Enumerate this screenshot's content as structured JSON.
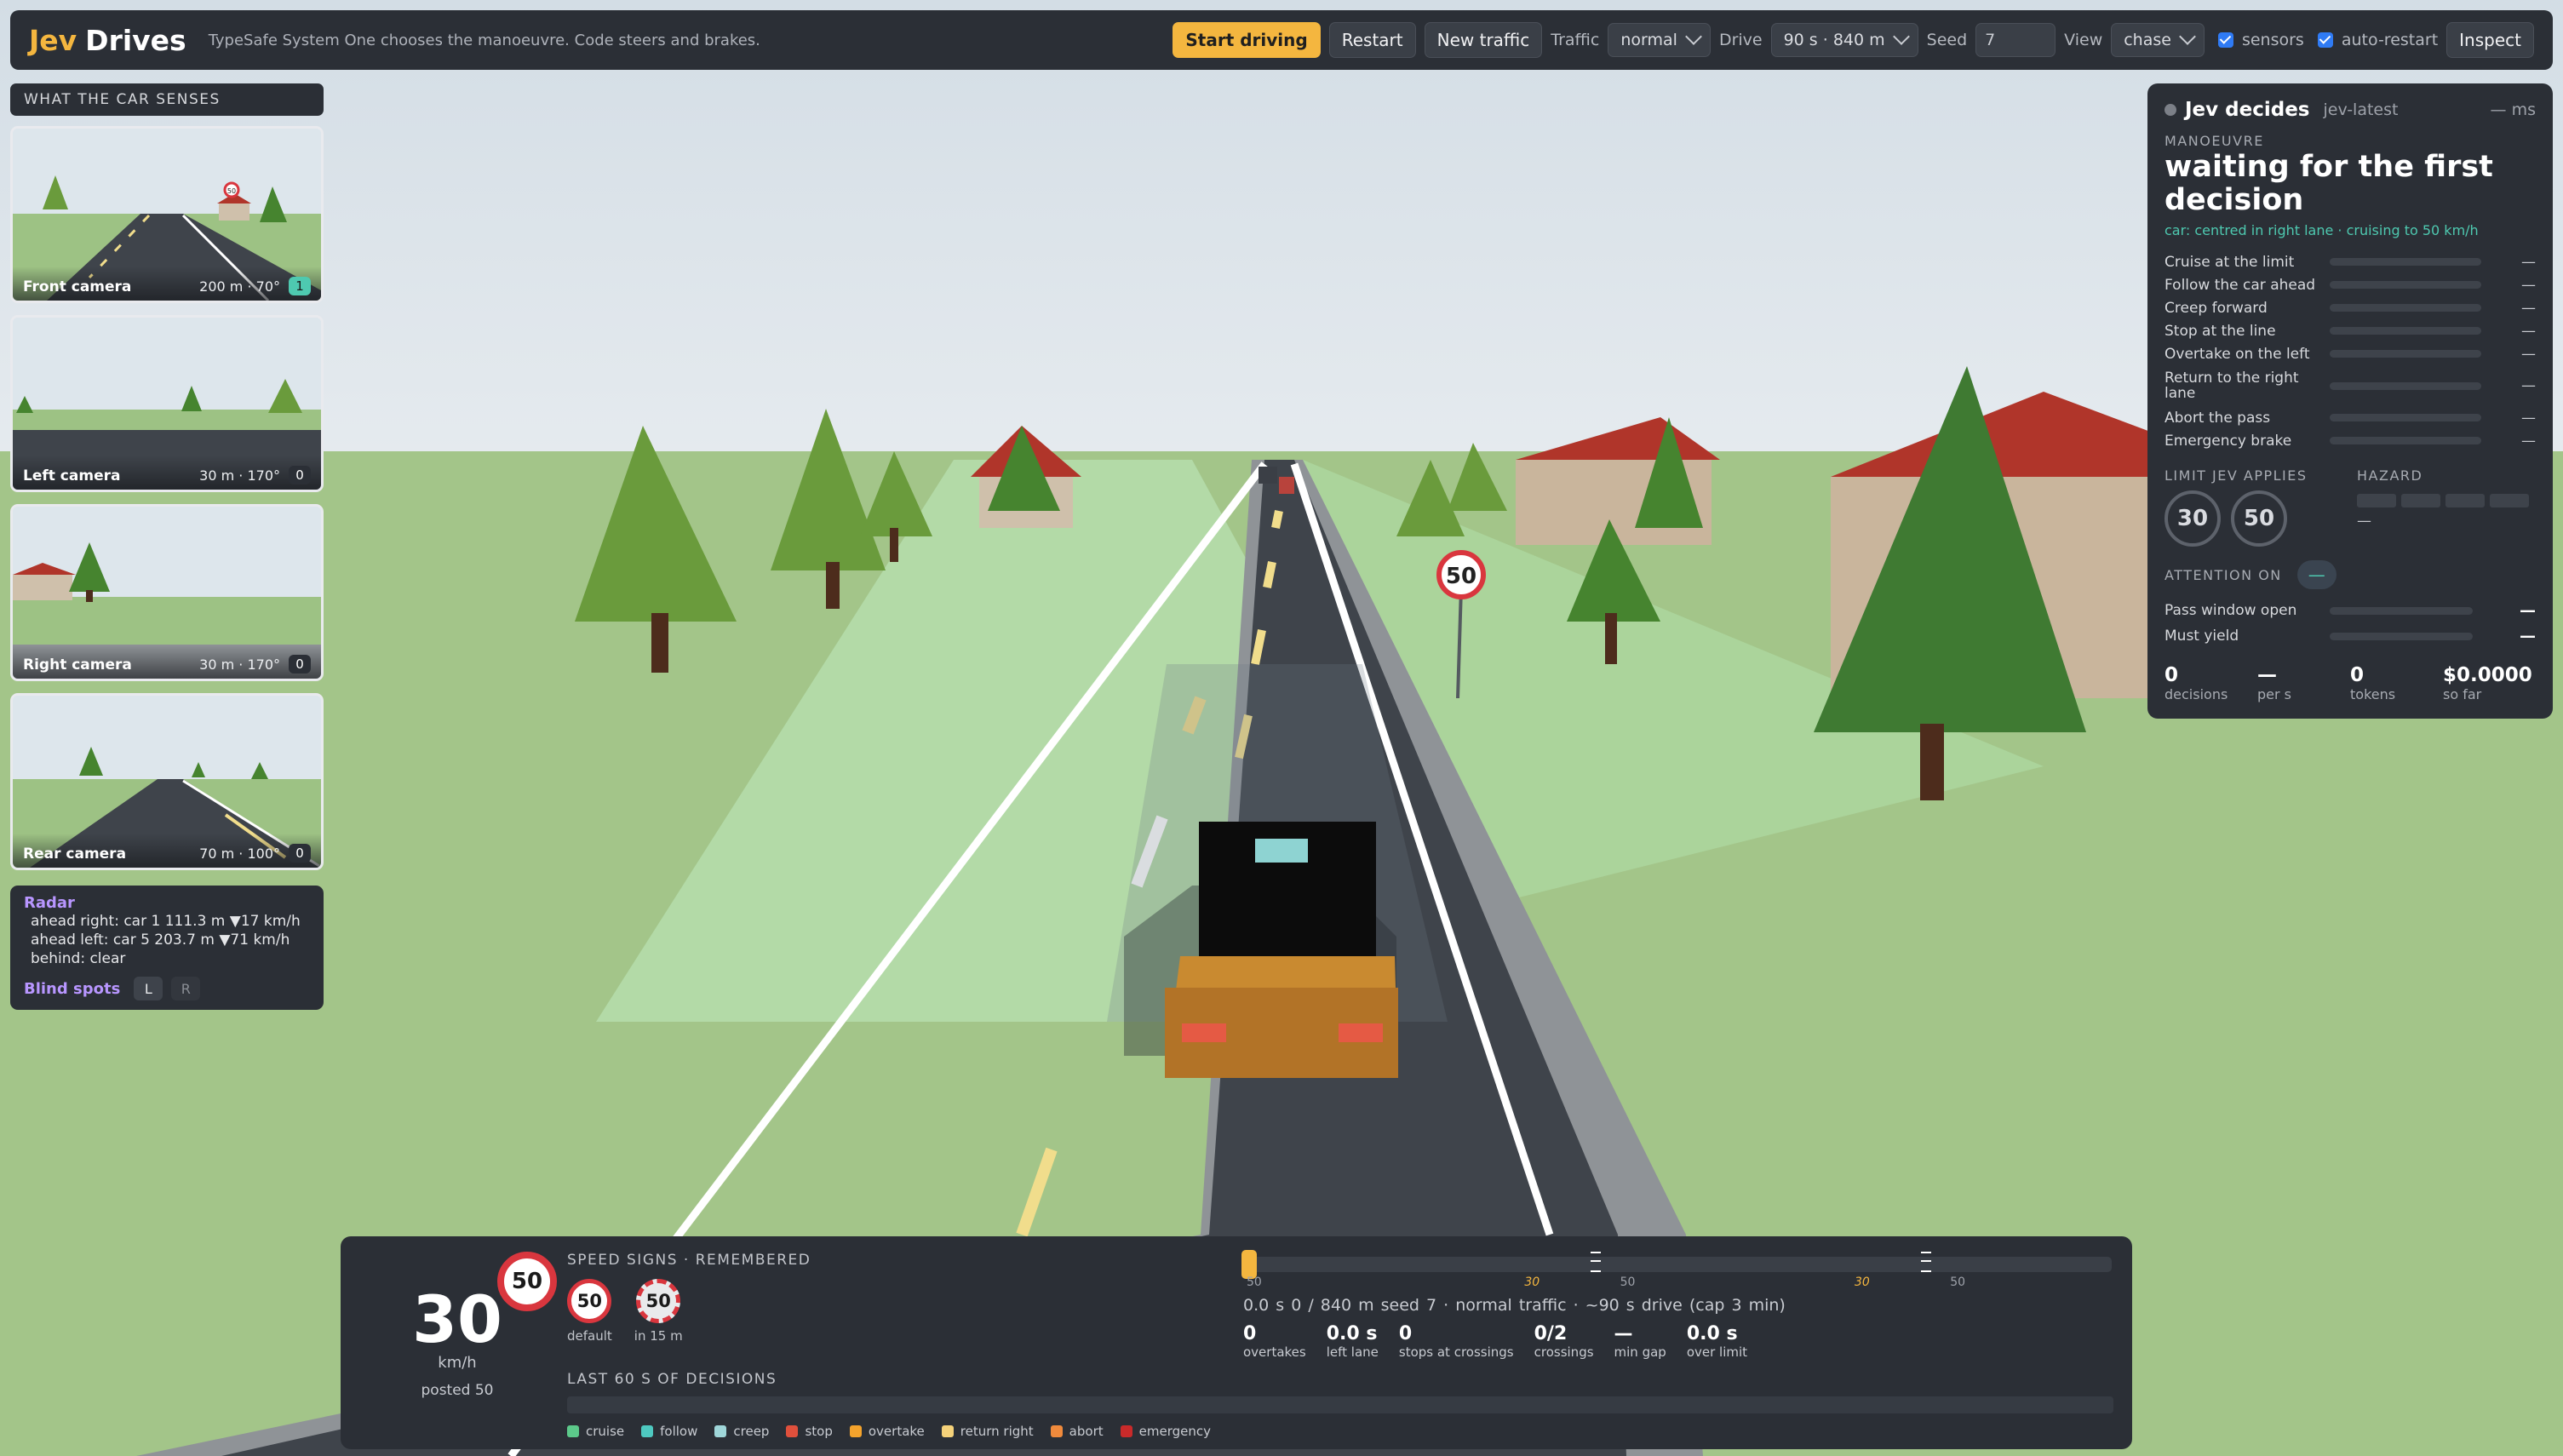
{
  "header": {
    "brand_accent": "Jev",
    "brand_name": "Drives",
    "tagline": "TypeSafe System One chooses the manoeuvre. Code steers and brakes.",
    "buttons": {
      "start": "Start driving",
      "restart": "Restart",
      "new_traffic": "New traffic",
      "inspect": "Inspect"
    },
    "traffic": {
      "label": "Traffic",
      "value": "normal"
    },
    "drive": {
      "label": "Drive",
      "value": "90 s · 840 m"
    },
    "seed": {
      "label": "Seed",
      "value": "7"
    },
    "view": {
      "label": "View",
      "value": "chase"
    },
    "sensors": {
      "label": "sensors",
      "checked": true
    },
    "auto_restart": {
      "label": "auto-restart",
      "checked": true
    }
  },
  "senses": {
    "title": "WHAT THE CAR SENSES",
    "cameras": [
      {
        "label": "Front camera",
        "meta": "200 m · 70°",
        "count": "1",
        "highlight": true
      },
      {
        "label": "Left camera",
        "meta": "30 m · 170°",
        "count": "0",
        "highlight": false
      },
      {
        "label": "Right camera",
        "meta": "30 m · 170°",
        "count": "0",
        "highlight": false
      },
      {
        "label": "Rear camera",
        "meta": "70 m · 100°",
        "count": "0",
        "highlight": false
      }
    ],
    "front_sign": "50",
    "radar": {
      "title": "Radar",
      "lines": [
        "ahead right: car 1 111.3 m ▼17 km/h",
        "ahead left: car 5 203.7 m ▼71 km/h",
        "behind: clear"
      ]
    },
    "blind_spots": {
      "title": "Blind spots",
      "left": "L",
      "right": "R"
    }
  },
  "decision": {
    "title": "Jev decides",
    "model": "jev-latest",
    "latency": "— ms",
    "manoeuvre_label": "MANOEUVRE",
    "manoeuvre": "waiting for the first decision",
    "car_status": "car: centred in right lane · cruising to 50 km/h",
    "options": [
      {
        "name": "Cruise at the limit",
        "value": "—"
      },
      {
        "name": "Follow the car ahead",
        "value": "—"
      },
      {
        "name": "Creep forward",
        "value": "—"
      },
      {
        "name": "Stop at the line",
        "value": "—"
      },
      {
        "name": "Overtake on the left",
        "value": "—"
      },
      {
        "name": "Return to the right lane",
        "value": "—"
      },
      {
        "name": "Abort the pass",
        "value": "—"
      },
      {
        "name": "Emergency brake",
        "value": "—"
      }
    ],
    "limit_label": "LIMIT JEV APPLIES",
    "limits": [
      "30",
      "50"
    ],
    "hazard_label": "HAZARD",
    "hazard_value": "—",
    "attention_label": "ATTENTION ON",
    "attention_value": "—",
    "flags": [
      {
        "name": "Pass window open",
        "value": "—"
      },
      {
        "name": "Must yield",
        "value": "—"
      }
    ],
    "stats": [
      {
        "value": "0",
        "label": "decisions"
      },
      {
        "value": "—",
        "label": "per s"
      },
      {
        "value": "0",
        "label": "tokens"
      },
      {
        "value": "$0.0000",
        "label": "so far"
      }
    ]
  },
  "hud": {
    "speed": "30",
    "unit": "km/h",
    "posted": "posted 50",
    "current_sign": "50",
    "memory_title": "SPEED SIGNS · REMEMBERED",
    "remembered": [
      {
        "value": "50",
        "caption": "default",
        "upcoming": false
      },
      {
        "value": "50",
        "caption": "in 15 m",
        "upcoming": true
      }
    ],
    "progress": {
      "fraction": 0.0,
      "ticks": [
        {
          "text": "50",
          "at": 0.0,
          "yellow": false
        },
        {
          "text": "30",
          "at": 0.32,
          "yellow": true
        },
        {
          "text": "50",
          "at": 0.43,
          "yellow": false
        },
        {
          "text": "30",
          "at": 0.7,
          "yellow": true
        },
        {
          "text": "50",
          "at": 0.81,
          "yellow": false
        }
      ],
      "markers": [
        0.4,
        0.78
      ],
      "status": "0.0 s   0 / 840 m   seed 7 · normal traffic · ~90 s drive (cap 3 min)"
    },
    "stats": [
      {
        "value": "0",
        "label": "overtakes"
      },
      {
        "value": "0.0 s",
        "label": "left lane"
      },
      {
        "value": "0",
        "label": "stops at crossings"
      },
      {
        "value": "0/2",
        "label": "crossings"
      },
      {
        "value": "—",
        "label": "min gap"
      },
      {
        "value": "0.0 s",
        "label": "over limit"
      }
    ],
    "history_title": "LAST 60 S OF DECISIONS",
    "legend": [
      {
        "name": "cruise",
        "color": "#5cc98a"
      },
      {
        "name": "follow",
        "color": "#4ec9c0"
      },
      {
        "name": "creep",
        "color": "#9fd6d9"
      },
      {
        "name": "stop",
        "color": "#e0503c"
      },
      {
        "name": "overtake",
        "color": "#f4a32c"
      },
      {
        "name": "return right",
        "color": "#f5d27a"
      },
      {
        "name": "abort",
        "color": "#f08a3c"
      },
      {
        "name": "emergency",
        "color": "#c92a2a"
      }
    ]
  },
  "scene": {
    "road_sign": "50"
  }
}
